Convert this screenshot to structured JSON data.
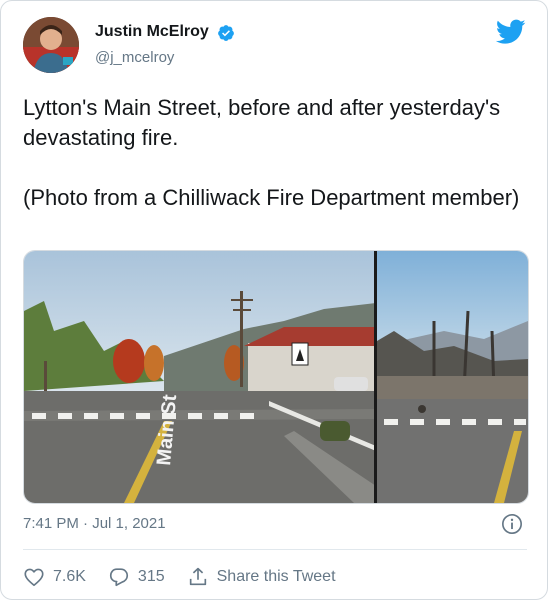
{
  "author": {
    "name": "Justin McElroy",
    "handle": "@j_mcelroy",
    "verified": true
  },
  "tweet": {
    "text_line1": "Lytton's Main Street, before and after yesterday's devastating fire.",
    "text_line2": "(Photo from a Chilliwack Fire Department member)",
    "timestamp": "7:41 PM · Jul 1, 2021"
  },
  "photo": {
    "street_sign": "Main St"
  },
  "actions": {
    "likes": "7.6K",
    "replies": "315",
    "share_label": "Share this Tweet"
  },
  "colors": {
    "twitter_blue": "#1da1f2",
    "secondary_text": "#657786"
  },
  "icons": [
    "verified-badge-icon",
    "twitter-bird-icon",
    "info-icon",
    "heart-icon",
    "reply-icon",
    "share-icon"
  ]
}
